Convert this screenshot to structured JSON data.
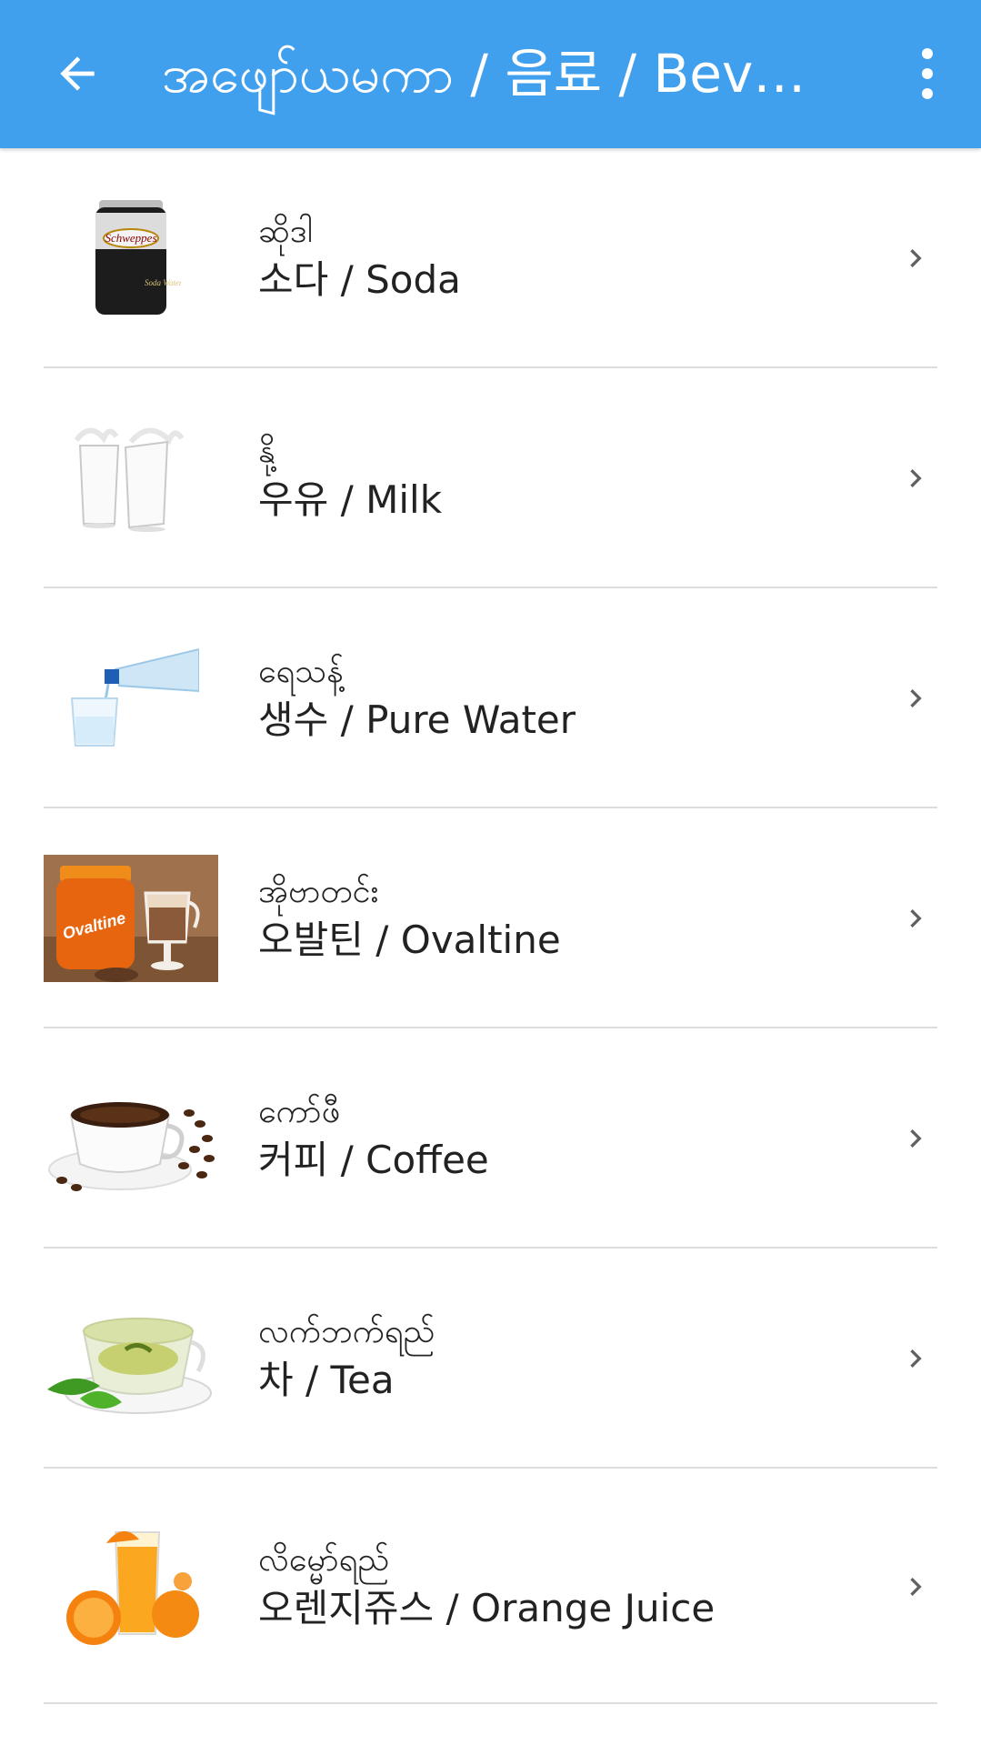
{
  "appbar": {
    "title": "အဖျော်ယမကာ / 음료 / Bever...",
    "back_icon": "arrow-left-icon",
    "menu_icon": "more-vertical-icon",
    "color": "#41a0ee"
  },
  "items": [
    {
      "mm": "ဆိုဒါ",
      "label": "소다  /  Soda",
      "image": "soda-can"
    },
    {
      "mm": "နို့",
      "label": "우유  /  Milk",
      "image": "milk-glasses"
    },
    {
      "mm": "ရေသန့်",
      "label": "생수  /  Pure Water",
      "image": "water-bottle"
    },
    {
      "mm": "အိုဗာတင်း",
      "label": "오발틴  /  Ovaltine",
      "image": "ovaltine-jar"
    },
    {
      "mm": "ကော်ဖီ",
      "label": "커피  /  Coffee",
      "image": "coffee-cup"
    },
    {
      "mm": "လက်ဘက်ရည်",
      "label": "차  /  Tea",
      "image": "tea-cup"
    },
    {
      "mm": "လိမ္မော်ရည်",
      "label": "오렌지쥬스  /  Orange Juice",
      "image": "orange-juice"
    }
  ]
}
